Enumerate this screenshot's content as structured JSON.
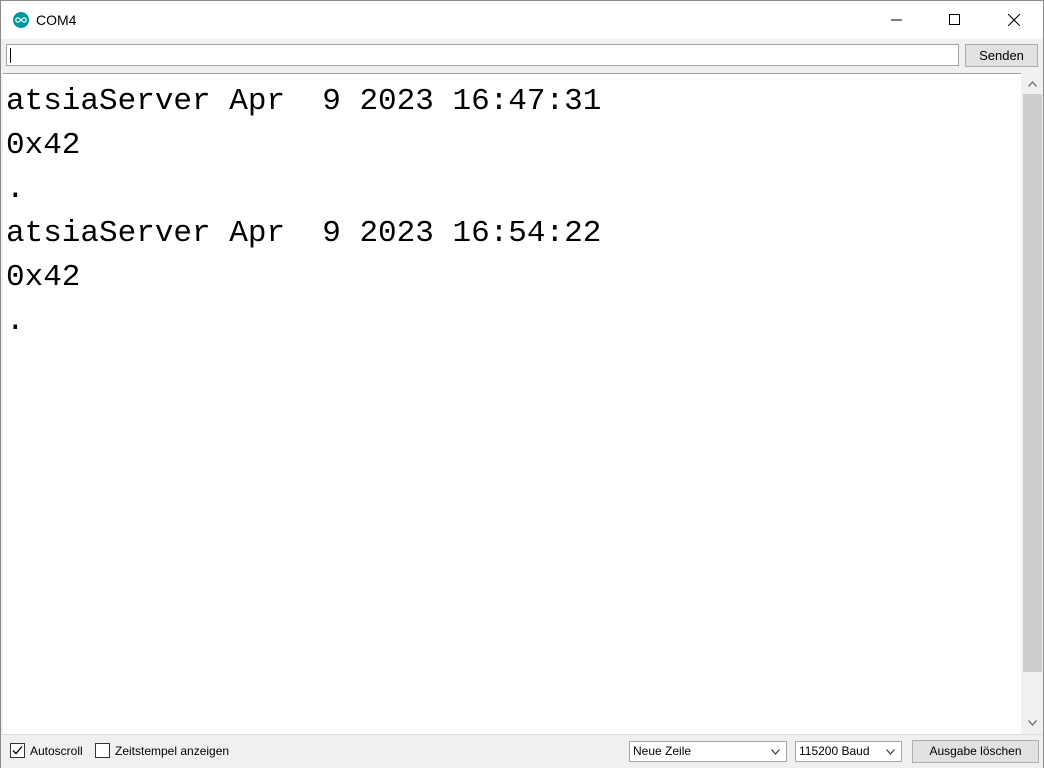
{
  "window": {
    "title": "COM4",
    "icon": "arduino-infinity-icon",
    "controls": [
      "minimize-icon",
      "maximize-icon",
      "close-icon"
    ]
  },
  "send_bar": {
    "input_value": "",
    "send_label": "Senden"
  },
  "output": {
    "lines": [
      "atsiaServer Apr  9 2023 16:47:31",
      "0x42",
      ".",
      "atsiaServer Apr  9 2023 16:54:22",
      "0x42",
      "."
    ]
  },
  "bottom_bar": {
    "autoscroll_label": "Autoscroll",
    "autoscroll_checked": true,
    "timestamp_label": "Zeitstempel anzeigen",
    "timestamp_checked": false,
    "line_ending_selected": "Neue Zeile",
    "baud_selected": "115200 Baud",
    "clear_label": "Ausgabe löschen"
  },
  "colors": {
    "accent": "#00979c",
    "chrome": "#f0f0f0",
    "button_face": "#e1e1e1",
    "scroll_thumb": "#cdcdcd"
  }
}
